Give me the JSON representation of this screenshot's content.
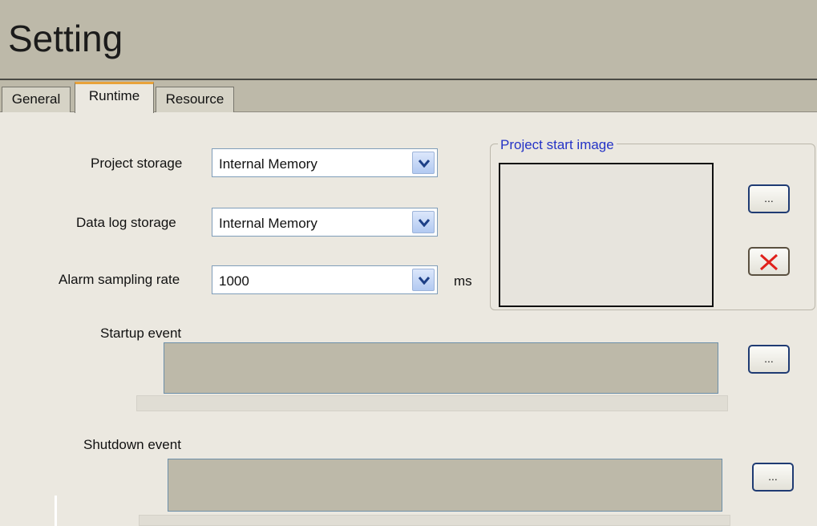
{
  "header": {
    "title": "Setting"
  },
  "tabs": [
    {
      "label": "General"
    },
    {
      "label": "Runtime"
    },
    {
      "label": "Resource"
    }
  ],
  "runtime": {
    "project_storage": {
      "label": "Project storage",
      "value": "Internal Memory"
    },
    "data_log_storage": {
      "label": "Data log storage",
      "value": "Internal Memory"
    },
    "alarm_sampling_rate": {
      "label": "Alarm sampling rate",
      "value": "1000",
      "unit": "ms"
    },
    "startup_event": {
      "label": "Startup event",
      "browse_label": "..."
    },
    "shutdown_event": {
      "label": "Shutdown event",
      "browse_label": "..."
    },
    "project_start_image": {
      "title": "Project start image",
      "browse_label": "..."
    }
  },
  "icons": {
    "dropdown": "chevron-down-icon",
    "clear": "close-icon"
  },
  "colors": {
    "header_bg": "#bdb9a9",
    "active_tab_accent": "#e8a23a",
    "groupbox_title": "#2433c6",
    "clear_icon": "#e0201a"
  }
}
